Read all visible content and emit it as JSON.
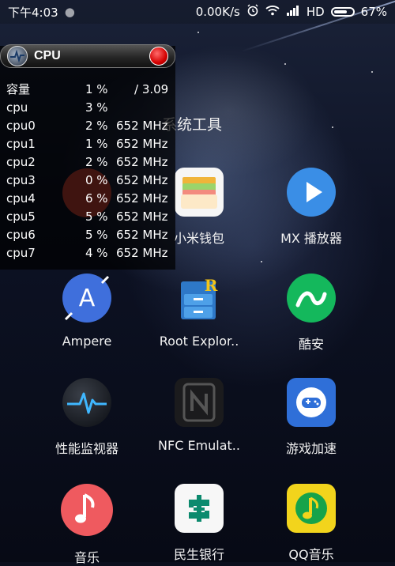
{
  "status_bar": {
    "time": "下午4:03",
    "network_speed": "0.00K/s",
    "network_type": "HD",
    "battery": "67%"
  },
  "cpu_overlay": {
    "title": "CPU",
    "rows": [
      {
        "name": "容量",
        "percent": "1 %",
        "freq": "/ 3.09"
      },
      {
        "name": "cpu",
        "percent": "3 %",
        "freq": ""
      },
      {
        "name": "cpu0",
        "percent": "2 %",
        "freq": "652 MHz"
      },
      {
        "name": "cpu1",
        "percent": "1 %",
        "freq": "652 MHz"
      },
      {
        "name": "cpu2",
        "percent": "2 %",
        "freq": "652 MHz"
      },
      {
        "name": "cpu3",
        "percent": "0 %",
        "freq": "652 MHz"
      },
      {
        "name": "cpu4",
        "percent": "6 %",
        "freq": "652 MHz"
      },
      {
        "name": "cpu5",
        "percent": "5 %",
        "freq": "652 MHz"
      },
      {
        "name": "cpu6",
        "percent": "5 %",
        "freq": "652 MHz"
      },
      {
        "name": "cpu7",
        "percent": "4 %",
        "freq": "652 MHz"
      }
    ]
  },
  "folder": {
    "title": "系统工具"
  },
  "apps": [
    {
      "label": "小米钱包",
      "icon": "wallet-icon"
    },
    {
      "label": "MX 播放器",
      "icon": "play-icon",
      "color": "#3a8ee6"
    },
    {
      "label": "Ampere",
      "icon": "ampere-icon",
      "color": "#3f6fdc"
    },
    {
      "label": "Root Explor..",
      "icon": "file-cabinet-icon"
    },
    {
      "label": "酷安",
      "icon": "coolapk-icon",
      "color": "#14b85c"
    },
    {
      "label": "性能监视器",
      "icon": "heartbeat-icon"
    },
    {
      "label": "NFC Emulat..",
      "icon": "nfc-icon"
    },
    {
      "label": "游戏加速",
      "icon": "gamepad-icon",
      "color": "#2f6fd8"
    },
    {
      "label": "音乐",
      "icon": "music-note-icon",
      "color": "#ef5a5f"
    },
    {
      "label": "民生银行",
      "icon": "bank-icon",
      "color": "#0c8a6e"
    },
    {
      "label": "QQ音乐",
      "icon": "qq-music-icon",
      "color": "#f2d41c"
    }
  ]
}
